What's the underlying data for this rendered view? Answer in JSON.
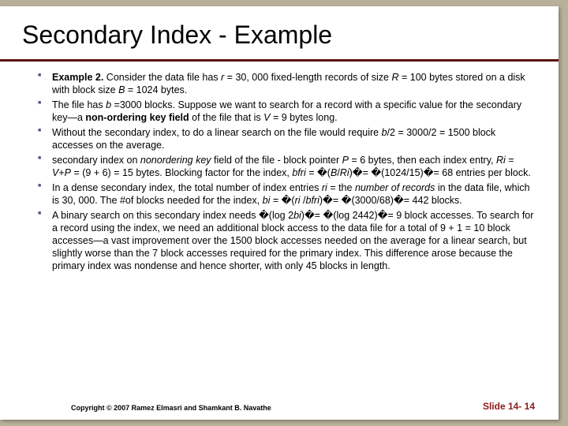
{
  "title": "Secondary Index - Example",
  "bullets": [
    "<b>Example 2.</b> Consider the data file has <i>r</i> = 30, 000 fixed-length records of size <i>R</i> = 100 bytes stored on a disk with block size <i>B</i> = 1024 bytes.",
    "The file has <i>b</i> =3000 blocks. Suppose we want to search for a record with a specific value for the secondary key—a <b>non-ordering key field</b> of the file that is <i>V</i> = 9 bytes long.",
    "Without the secondary index, to do a linear search on the file would require <i>b</i>/2 = 3000/2 = 1500 block accesses on the average.",
    "secondary index on <i>nonordering key</i> field of the file - block pointer <i>P</i> = 6 bytes, then each index entry, <i>Ri</i> = <i>V</i>+<i>P</i> = (9 + 6) = 15 bytes. Blocking factor for the index, <i>bfri</i> = �(<i>B</i>/<i>Ri</i>)�= �(1024/15)�= 68 entries per block.",
    "In a dense secondary index, the total number of index entries <i>ri</i> = the <i>number of records</i> in the data file, which is 30, 000. The #of blocks needed for the index, <i>bi</i> = �(<i>ri</i> /<i>bfri</i>)�= �(3000/68)�= 442 blocks.",
    "A binary search on this secondary index needs �(log 2<i>bi</i>)�= �(log 2442)�= 9 block accesses. To search for a record using the index, we need an additional block access to the data file for a total of 9 + 1 = 10 block accesses—a vast improvement over the 1500 block accesses needed on the average for a linear search, but slightly worse than the 7 block accesses required for the primary index. This difference arose because the primary index was nondense and hence shorter, with only 45 blocks in length."
  ],
  "copyright": "Copyright © 2007 Ramez Elmasri and Shamkant B. Navathe",
  "slidenum": "Slide 14- 14"
}
